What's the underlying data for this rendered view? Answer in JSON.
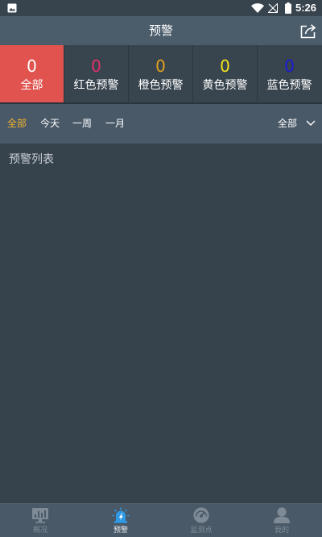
{
  "status_bar": {
    "time": "5:26",
    "icons": [
      "image-icon",
      "wifi-icon",
      "no-signal-icon",
      "battery-icon"
    ]
  },
  "header": {
    "title": "预警",
    "action_icon": "share-icon"
  },
  "stats": [
    {
      "count": "0",
      "label": "全部",
      "color": "#ffffff",
      "active": true
    },
    {
      "count": "0",
      "label": "红色预警",
      "color": "#e0306a",
      "active": false
    },
    {
      "count": "0",
      "label": "橙色预警",
      "color": "#e3a220",
      "active": false
    },
    {
      "count": "0",
      "label": "黄色预警",
      "color": "#f2e31e",
      "active": false
    },
    {
      "count": "0",
      "label": "蓝色预警",
      "color": "#1a1ad8",
      "active": false
    }
  ],
  "filters": {
    "periods": [
      "全部",
      "今天",
      "一周",
      "一月"
    ],
    "active_index": 0,
    "level_select": "全部",
    "level_icon": "chevron-down-icon"
  },
  "main": {
    "section_title": "预警列表"
  },
  "bottom_nav": [
    {
      "label": "概况",
      "icon": "chart-icon",
      "active": false
    },
    {
      "label": "预警",
      "icon": "alarm-icon",
      "active": true
    },
    {
      "label": "监测点",
      "icon": "gauge-icon",
      "active": false
    },
    {
      "label": "我的",
      "icon": "user-icon",
      "active": false
    }
  ],
  "colors": {
    "active_stat_bg": "#e0534e",
    "filter_active": "#f0b22e",
    "nav_active": "#2f9be6",
    "nav_inactive": "#7e8a95"
  }
}
